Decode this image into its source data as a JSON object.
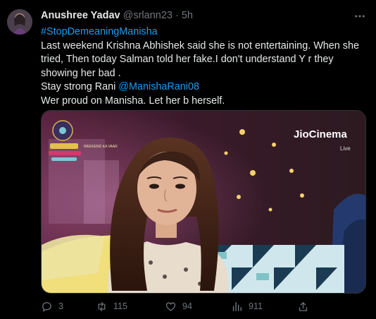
{
  "tweet": {
    "author": {
      "name": "Anushree Yadav",
      "handle": "@srlann23"
    },
    "separator": "·",
    "time": "5h",
    "hashtag": "#StopDemeaningManisha",
    "lines": [
      "Last weekend Krishna Abhishek said  she is not entertaining. When she tried, Then today Salman told her fake.I don't understand Y r they showing her bad ."
    ],
    "strong_prefix": "Stay strong Rani ",
    "mention": "@ManishaRani08",
    "closing": "Wer proud on Manisha. Let her b herself."
  },
  "media": {
    "watermark": "JioCinema",
    "watermark_sub": "Live",
    "show_logo_text": "WEEKEND KA VAAR"
  },
  "actions": {
    "replies": "3",
    "retweets": "115",
    "likes": "94",
    "views": "911"
  },
  "colors": {
    "link": "#1d9bf0",
    "muted": "#71767b",
    "text": "#e7e9ea"
  }
}
